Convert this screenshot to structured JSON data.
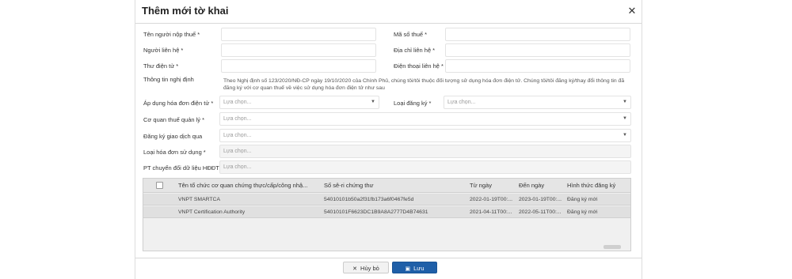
{
  "dialog": {
    "title": "Thêm mới tờ khai",
    "close_icon": "close-icon"
  },
  "form": {
    "taxpayer_name": {
      "label": "Tên người nộp thuế",
      "required": "*",
      "value": ""
    },
    "tax_code": {
      "label": "Mã số thuế",
      "required": "*",
      "value": ""
    },
    "contact_person": {
      "label": "Người liên hệ",
      "required": "*",
      "value": ""
    },
    "contact_address": {
      "label": "Địa chỉ liên hệ",
      "required": "*",
      "value": ""
    },
    "email": {
      "label": "Thư điện tử",
      "required": "*",
      "value": ""
    },
    "contact_phone": {
      "label": "Điện thoại liên hệ",
      "required": "*",
      "value": ""
    },
    "decree_info": {
      "label": "Thông tin nghị định",
      "text": "Theo Nghị định số 123/2020/NĐ-CP ngày 19/10/2020 của Chính Phủ, chúng tôi/tôi thuộc đối tượng sử dụng hóa đơn điện tử. Chúng tôi/tôi đăng ký/thay đổi thông tin đã đăng ký với cơ quan thuế về việc sử dụng hóa đơn điện tử như sau"
    },
    "apply_einvoice": {
      "label": "Áp dụng hóa đơn điện tử",
      "required": "*",
      "placeholder": "Lựa chọn..."
    },
    "registration_type": {
      "label": "Loại đăng ký",
      "required": "*",
      "placeholder": "Lựa chọn..."
    },
    "tax_authority": {
      "label": "Cơ quan thuế quản lý",
      "required": "*",
      "placeholder": "Lựa chọn..."
    },
    "register_via": {
      "label": "Đăng ký giao dịch qua",
      "required": "",
      "placeholder": "Lựa chọn..."
    },
    "invoice_type": {
      "label": "Loại hóa đơn sử dụng",
      "required": "*",
      "placeholder": "Lựa chọn..."
    },
    "data_transfer": {
      "label": "PT chuyển đổi dữ liệu HĐĐT",
      "required": "*",
      "placeholder": "Lựa chọn..."
    }
  },
  "grid": {
    "columns": {
      "org": "Tên tổ chức cơ quan chứng thực/cấp/công nhậ...",
      "serial": "Số sê-ri chứng thư",
      "from": "Từ ngày",
      "to": "Đến ngày",
      "form": "Hình thức đăng ký"
    },
    "rows": [
      {
        "org": "VNPT SMARTCA",
        "serial": "54010101b50a2f31fb173a6f0467fe5d",
        "from": "2022-01-19T00:...",
        "to": "2023-01-19T00:...",
        "form": "Đăng ký mới"
      },
      {
        "org": "VNPT Certification Authority",
        "serial": "54010101F6623DC1B9A8A2777D4B74631",
        "from": "2021-04-11T00:...",
        "to": "2022-05-11T00:...",
        "form": "Đăng ký mới"
      }
    ]
  },
  "footer": {
    "cancel_label": "Hủy bỏ",
    "save_label": "Lưu"
  },
  "colors": {
    "primary": "#1f5fa8",
    "grid_row": "#e0e0e0"
  }
}
